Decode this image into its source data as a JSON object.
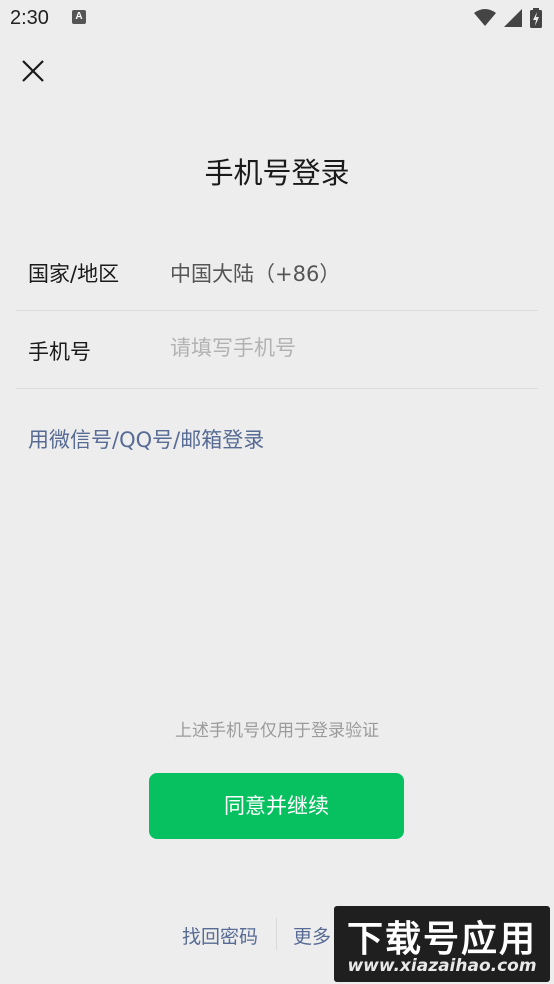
{
  "status_bar": {
    "time": "2:30",
    "notification_icon": "A"
  },
  "header": {
    "title": "手机号登录"
  },
  "form": {
    "country_label": "国家/地区",
    "country_value": "中国大陆（+86）",
    "phone_label": "手机号",
    "phone_placeholder": "请填写手机号",
    "phone_value": ""
  },
  "alt_login_link": "用微信号/QQ号/邮箱登录",
  "notice": "上述手机号仅用于登录验证",
  "continue_button": "同意并继续",
  "bottom_links": {
    "find_password": "找回密码",
    "more": "更多"
  },
  "watermark": {
    "title": "下载号应用",
    "url": "www.xiazaihao.com"
  },
  "colors": {
    "background": "#ededed",
    "primary_green": "#07c160",
    "link_blue": "#576b95"
  },
  "icons": [
    "notification-a-icon",
    "wifi-icon",
    "signal-icon",
    "battery-charging-icon",
    "close-icon"
  ]
}
